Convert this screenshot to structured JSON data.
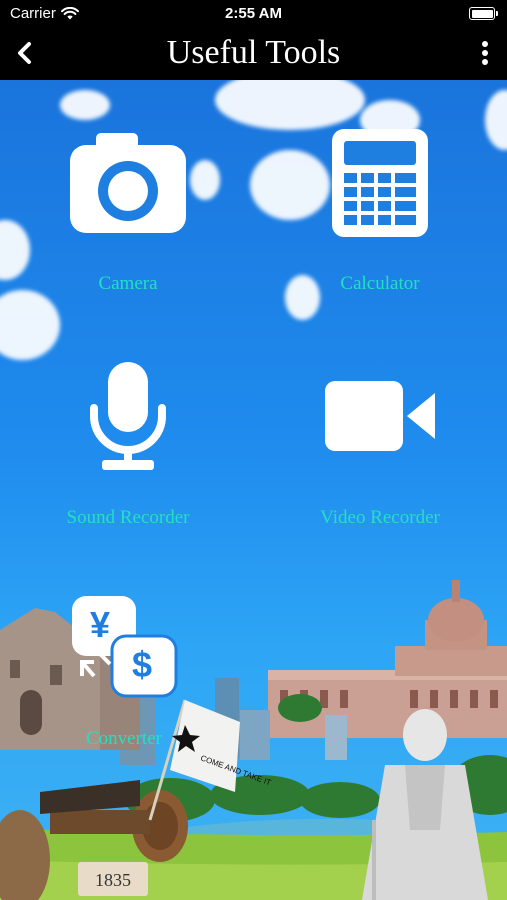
{
  "status_bar": {
    "carrier": "Carrier",
    "time": "2:55 AM"
  },
  "nav": {
    "title": "Useful Tools",
    "back_icon": "chevron-left-icon",
    "menu_icon": "more-vertical-icon"
  },
  "tools": [
    {
      "label": "Camera",
      "icon": "camera-icon"
    },
    {
      "label": "Calculator",
      "icon": "calculator-icon"
    },
    {
      "label": "Sound Recorder",
      "icon": "microphone-icon"
    },
    {
      "label": "Video Recorder",
      "icon": "video-camera-icon"
    },
    {
      "label": "Converter",
      "icon": "currency-converter-icon",
      "symbols": [
        "¥",
        "$"
      ]
    }
  ],
  "scene": {
    "plaque_text": "1835",
    "flag_text": "COME AND TAKE IT"
  },
  "colors": {
    "label": "#22e1c0",
    "sky_top": "#1a74dc",
    "nav_bg": "#000000"
  }
}
